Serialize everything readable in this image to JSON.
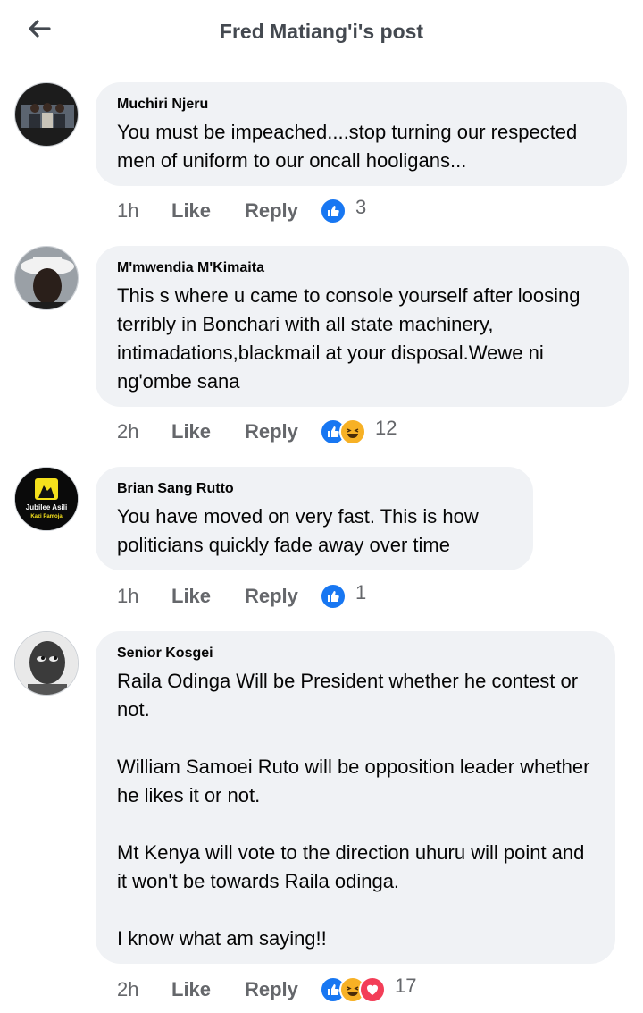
{
  "header": {
    "title": "Fred Matiang'i's post"
  },
  "colors": {
    "bubble": "#f0f2f5",
    "like": "#1877f2",
    "haha": "#f7b125",
    "love": "#f33e58",
    "meta": "#65676b"
  },
  "comments": [
    {
      "author": "Muchiri Njeru",
      "text": "You must be impeached....stop turning our respected men of uniform to our oncall hooligans...",
      "time": "1h",
      "like_label": "Like",
      "reply_label": "Reply",
      "reactions": [
        "like-icon"
      ],
      "reaction_count": "3"
    },
    {
      "author": "M'mwendia M'Kimaita",
      "text": "This s where u came to console yourself after loosing terribly in Bonchari with all state machinery, intimadations,blackmail at your disposal.Wewe ni ng'ombe sana",
      "time": "2h",
      "like_label": "Like",
      "reply_label": "Reply",
      "reactions": [
        "like-icon",
        "haha-icon"
      ],
      "reaction_count": "12"
    },
    {
      "author": "Brian Sang Rutto",
      "avatar_text": {
        "line1": "Jubilee Asili",
        "line2": "Kazi Pamoja"
      },
      "text": "You have moved on very fast. This is how politicians quickly fade away over time",
      "time": "1h",
      "like_label": "Like",
      "reply_label": "Reply",
      "reactions": [
        "like-icon"
      ],
      "reaction_count": "1"
    },
    {
      "author": "Senior Kosgei",
      "text": "Raila Odinga Will be President whether he contest or not.\n\nWilliam Samoei Ruto will be opposition leader whether he likes it or not.\n\nMt Kenya will vote to the direction uhuru will point and it won't be towards Raila odinga.\n\nI know what am saying!!",
      "time": "2h",
      "like_label": "Like",
      "reply_label": "Reply",
      "reactions": [
        "like-icon",
        "haha-icon",
        "love-icon"
      ],
      "reaction_count": "17"
    }
  ]
}
